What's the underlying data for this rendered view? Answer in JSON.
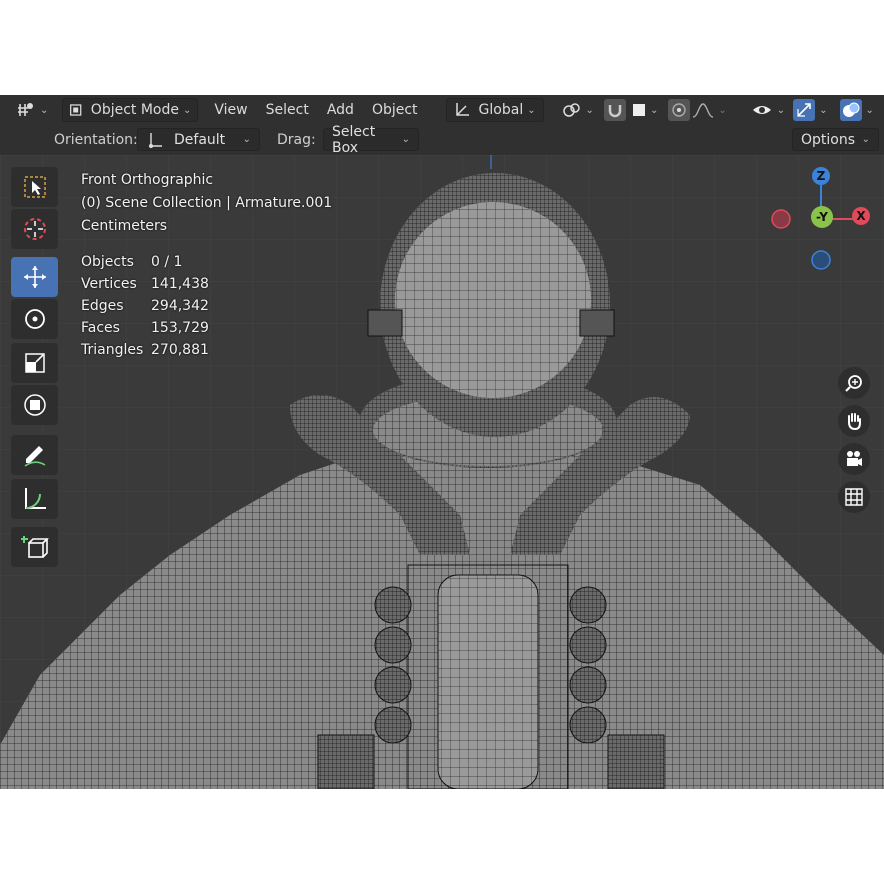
{
  "header": {
    "mode_label": "Object Mode",
    "menus": [
      "View",
      "Select",
      "Add",
      "Object"
    ],
    "transform_orientation": "Global"
  },
  "toolbar": {
    "orientation_label": "Orientation:",
    "orientation_value": "Default",
    "drag_label": "Drag:",
    "drag_value": "Select Box",
    "options_label": "Options"
  },
  "viewport": {
    "view_name": "Front Orthographic",
    "collection": "(0) Scene Collection | Armature.001",
    "units": "Centimeters",
    "stats": [
      {
        "label": "Objects",
        "value": "0 / 1"
      },
      {
        "label": "Vertices",
        "value": "141,438"
      },
      {
        "label": "Edges",
        "value": "294,342"
      },
      {
        "label": "Faces",
        "value": "153,729"
      },
      {
        "label": "Triangles",
        "value": "270,881"
      }
    ]
  },
  "gizmo": {
    "z": "Z",
    "y": "-Y",
    "x": "X"
  },
  "colors": {
    "accent": "#4772b3",
    "x_axis": "#e04a5a",
    "y_axis": "#8bc34a",
    "z_axis": "#3b82d9",
    "bg": "#3d3d3d"
  }
}
